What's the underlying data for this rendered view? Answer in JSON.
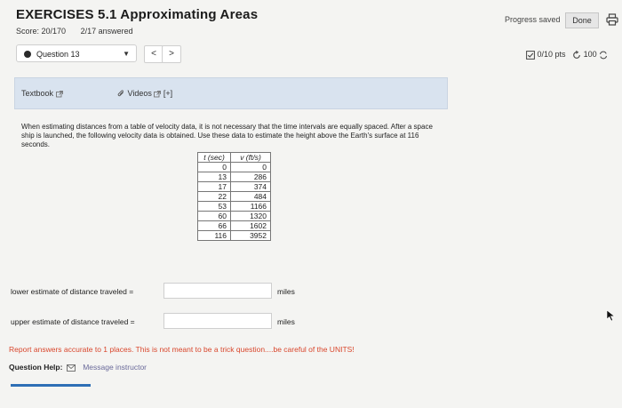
{
  "header": {
    "title": "EXERCISES 5.1 Approximating Areas",
    "score": "Score: 20/170",
    "answered": "2/17 answered",
    "progress": "Progress saved",
    "done_label": "Done"
  },
  "question_nav": {
    "selected": "Question 13",
    "prev": "<",
    "next": ">"
  },
  "points": {
    "pts": "0/10 pts",
    "retries": "100"
  },
  "resources": {
    "textbook": "Textbook",
    "videos": "Videos",
    "videos_extra": "[+]"
  },
  "problem": {
    "text": "When estimating distances from a table of velocity data, it is not necessary that the time intervals are equally spaced. After a space ship is launched, the following velocity data is obtained. Use these data to estimate the height above the Earth's surface at 116 seconds."
  },
  "table": {
    "headers": [
      "t (sec)",
      "v (ft/s)"
    ],
    "rows": [
      [
        "0",
        "0"
      ],
      [
        "13",
        "286"
      ],
      [
        "17",
        "374"
      ],
      [
        "22",
        "484"
      ],
      [
        "53",
        "1166"
      ],
      [
        "60",
        "1320"
      ],
      [
        "66",
        "1602"
      ],
      [
        "116",
        "3952"
      ]
    ]
  },
  "answers": {
    "lower_label": "lower estimate of distance traveled =",
    "upper_label": "upper estimate of distance traveled =",
    "lower_value": "",
    "upper_value": "",
    "unit": "miles"
  },
  "footer": {
    "report": "Report answers accurate to 1 places. This is not meant to be a trick question....be careful of the UNITS!",
    "help_label": "Question Help:",
    "message": "Message instructor"
  },
  "colors": {
    "accent_blue": "#2e6fb6",
    "warning_red": "#d9462c",
    "resource_bar": "#d9e3ef"
  },
  "icons": [
    "print-icon",
    "chevron-down-icon",
    "check-box-icon",
    "retry-icon",
    "external-link-icon",
    "paperclip-icon",
    "mail-icon"
  ]
}
